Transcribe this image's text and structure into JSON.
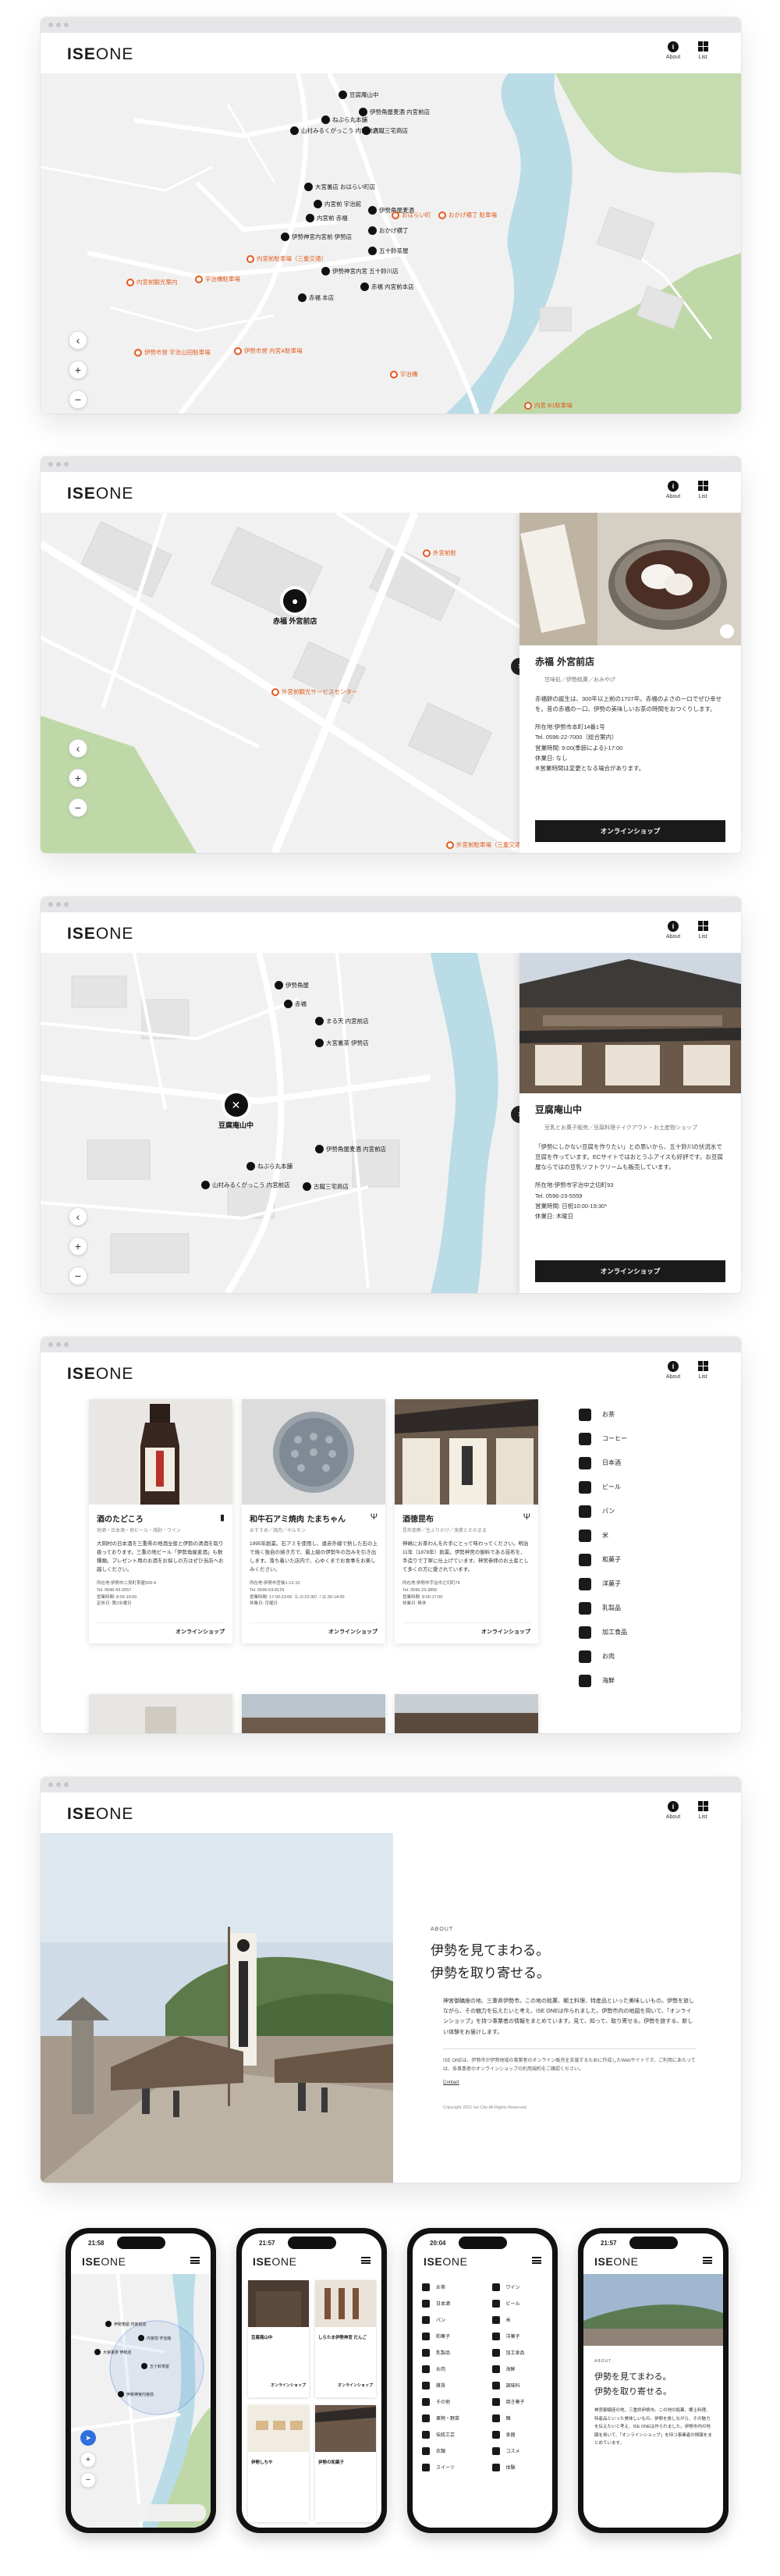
{
  "brand": {
    "logo_bold": "ISE",
    "logo_light": "ONE"
  },
  "header": {
    "about_label": "About",
    "list_label": "List",
    "about_glyph": "i"
  },
  "map_controls": {
    "back": "‹",
    "zoom_in": "+",
    "zoom_out": "−"
  },
  "map1": {
    "pins_black": [
      "豆腐庵山中",
      "伊勢角屋麦酒 内宮前店",
      "藤屋窓月",
      "ねぶら丸本舗",
      "山村みるくがっこう 内宮前店",
      "古蹴三宅商店",
      "大宮裏店 おはらい町店",
      "内宮前 宇治館",
      "伊勢角屋麦酒",
      "内宮前 赤福",
      "伊勢神宮内宮 五十鈴川店",
      "赤福 内宮前本店",
      "伊勢神宮内宮前 伊勢店",
      "おかげ横丁",
      "五十鈴茶屋",
      "宇治橋前 本店",
      "赤福 本店",
      "内宮前店"
    ],
    "pins_orange": [
      "宇治橋駐車場",
      "おかげ横丁 駐車場",
      "内宮前観光案内",
      "内宮前駐車場（三重交通）",
      "伊勢市営 宇治山田駐車場",
      "伊勢市営 内宮A駐車場",
      "おはらい町",
      "宇治橋",
      "内宮",
      "内宮 B1駐車場"
    ]
  },
  "map2": {
    "selected_pin": "赤福 外宮前店",
    "orange_pins": [
      "外宮前駐",
      "外宮前観光サービスセンター",
      "外宮前駐車場（三重交通）"
    ],
    "road_labels": [
      "外宮参道",
      "外宮前"
    ],
    "panel": {
      "name": "赤福 外宮前店",
      "category": "甘味処／伊勢銘菓／おみやげ",
      "description": "赤福餅の誕生は、300年以上前の1707年。赤福のよさの一ロでぜひ幸せを。昔の赤福の一口、伊勢の美味しいお茶の時間をおつくりします。",
      "address": "所在地:伊勢市本町14番1号",
      "tel": "Tel. 0596-22-7000（総合案内）",
      "hours": "営業時間: 9:00(季節による)-17:00",
      "closed": "休業日: なし",
      "note": "※営業時間は変更となる場合があります。",
      "shop_button": "オンラインショップ"
    }
  },
  "map3": {
    "selected_pin": "豆腐庵山中",
    "pins": [
      "伊勢角屋",
      "赤福",
      "まる天 内宮前店",
      "大宮裏茶 伊勢店",
      "ねぶら丸本舗",
      "伊勢角屋麦酒 内宮前店",
      "山村みるくがっこう 内宮前店",
      "古蹴三宅商店"
    ],
    "panel": {
      "name": "豆腐庵山中",
      "category": "豆乳とお菓子販売／豆腐料理テイクアウト・お土産物ショップ",
      "description": "「伊勢にしかない豆腐を作りたい」との思いから、五十鈴川の伏流水で豆腐を作っています。ECサイトではおとうふアイスも好評です。お豆腐屋ならではの豆乳ソフトクリームも販売しています。",
      "address": "所在地:伊勢市宇治中之切町93",
      "tel": "Tel. 0596-23-5559",
      "hours": "営業時間: 日祝10:00-19:30*",
      "closed": "休業日: 木曜日",
      "shop_button": "オンラインショップ"
    }
  },
  "list": {
    "cards": [
      {
        "name": "酒のたどころ",
        "category": "地酒・日本酒・地ビール・焼酎・ワイン",
        "description": "大岡村の日本酒を三重県の地酒全般と伊勢の清酒を取り扱っております。三重の地ビール「伊勢角屋麦酒」も数種類。プレゼント用のお酒をお探しの方はぜひ当店へお越しください。",
        "info": "所在地:伊勢市二見町茶屋569-4\nTel. 0596-43-2057\n営業時間: 8:00-19:00\n定休日: 第2水曜日",
        "link": "オンラインショップ",
        "icon": "bottle-icon"
      },
      {
        "name": "和牛石アミ焼肉 たまちゃん",
        "category": "おすすめ／焼肉／ホルモン",
        "description": "1995年創業。石アミを使用し、遠赤外線で熱した石の上で焼く独自の焼き方で、最上級の伊勢牛の旨みを引き出します。落ち着いた店内で、心ゆくまでお食事をお楽しみください。",
        "info": "所在地:伊勢市宮後1-12-10\nTel. 0596-63-8129\n営業時間: 17:00-23:00（L.O.22:30）/ 11:30-14:00\n休業日: 月曜日",
        "link": "オンラインショップ",
        "icon": "fork-icon"
      },
      {
        "name": "酒徳昆布",
        "category": "昆布佃煮／生ふりかけ／漁業とそのまま",
        "description": "伸嶋にお茶わんを片手にとって味わってください。明治11年（1878年）創業。伊勢神宮の御料である昆布を、手造りで丁寧に仕上げています。神宮参拝のお土産として多くの方に愛されています。",
        "info": "所在地:伊勢市宇治中之切町78\nTel. 0596-23-3855\n営業時間: 8:00-17:00\n休業日: 無休",
        "link": "オンラインショップ",
        "icon": "fork-icon"
      }
    ],
    "categories": [
      "お茶",
      "コーヒー",
      "日本酒",
      "ビール",
      "パン",
      "米",
      "和菓子",
      "洋菓子",
      "乳製品",
      "加工食品",
      "お肉",
      "海鮮"
    ]
  },
  "about": {
    "eyebrow": "ABOUT",
    "title_line1": "伊勢を見てまわる。",
    "title_line2": "伊勢を取り寄せる。",
    "body": "神宮御鎮座の地、三重県伊勢市。この地の銘菓、郷土料理、特産品といった美味しいもの。伊勢を旅しながら、その魅力を伝えたいと考え、ISE ONEは作られました。伊勢市内の地図を用いて、「オンラインショップ」を持つ事業者の情報をまとめています。見て、知って、取り寄せる。伊勢を旅する、新しい体験をお届けします。",
    "notes": "ISE ONEは、伊勢市が伊勢地域の事業者のオンライン販売を支援するために作成したWebサイトです。ご利用にあたっては、各事業者のオンラインショップの利用規約をご確認ください。",
    "contact": "Contact",
    "copyright": "Copyright 2021 Ise City All Rights Reserved."
  },
  "phones": [
    {
      "time": "21:58"
    },
    {
      "time": "21:57"
    },
    {
      "time": "20:04"
    },
    {
      "time": "21:57"
    }
  ],
  "phone1": {
    "pins": [
      "伊勢角屋 内宮前店",
      "内宮前 宇治館",
      "大宮裏茶 伊勢店",
      "五十鈴茶屋",
      "伊勢神宮内宮前"
    ]
  },
  "phone2": {
    "cards": [
      "豆腐庵山中",
      "しらたま伊勢神宮 だんご",
      "伊勢しちや",
      "伊勢の和菓子"
    ],
    "link": "オンラインショップ"
  },
  "phone3": {
    "categories": [
      "お茶",
      "ワイン",
      "日本酒",
      "ビール",
      "パン",
      "米",
      "和菓子",
      "洋菓子",
      "乳製品",
      "加工食品",
      "お肉",
      "海鮮",
      "雑貨",
      "調味料",
      "その他",
      "焼き菓子",
      "果物・野菜",
      "麺",
      "伝統工芸",
      "食器",
      "衣類",
      "コスメ",
      "スイーツ",
      "体験"
    ]
  },
  "phone4": {
    "eyebrow": "ABOUT",
    "title_line1": "伊勢を見てまわる。",
    "title_line2": "伊勢を取り寄せる。",
    "body": "神宮御鎮座の地、三重県伊勢市。この地の銘菓、郷土料理、特産品といった美味しいもの。伊勢を旅しながら、その魅力を伝えたいと考え、ISE ONEは作られました。伊勢市内の地図を用いて、「オンラインショップ」を持つ事業者の情報をまとめています。"
  }
}
